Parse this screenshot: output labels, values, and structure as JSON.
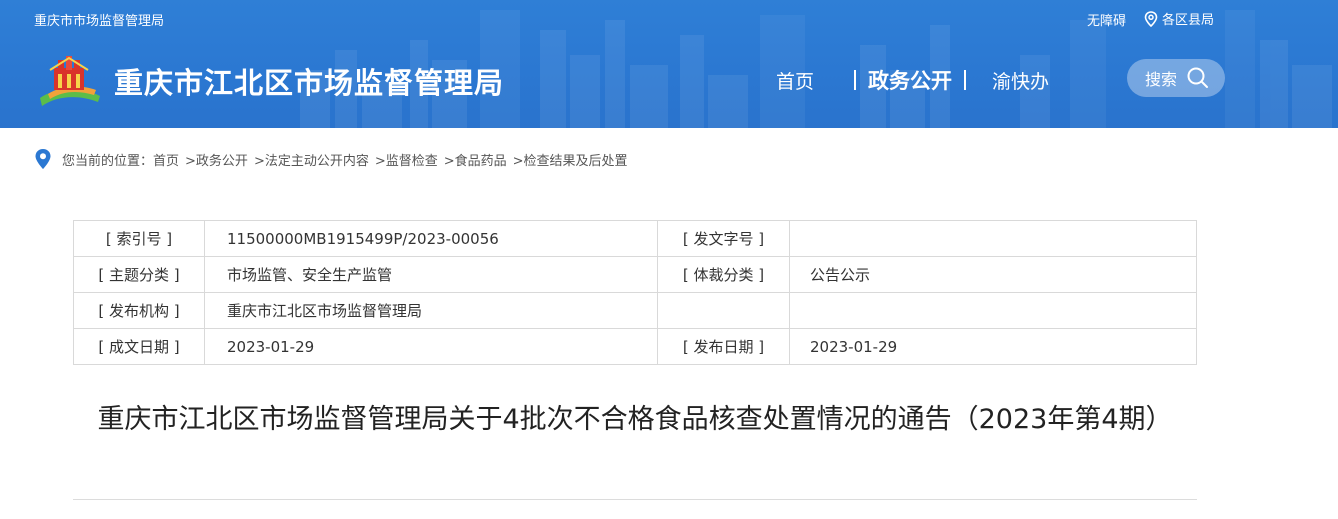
{
  "header": {
    "site_small": "重庆市市场监督管理局",
    "accessible": "无障碍",
    "district": "各区县局",
    "site_title": "重庆市江北区市场监督管理局",
    "nav": {
      "home": "首页",
      "gov": "政务公开",
      "yukuaiban": "渝快办"
    },
    "search_label": "搜索"
  },
  "breadcrumb": {
    "prefix": "您当前的位置：",
    "items": [
      "首页",
      ">政务公开",
      ">法定主动公开内容",
      ">监督检查",
      ">食品药品",
      ">检查结果及后处置"
    ]
  },
  "meta": {
    "rows": [
      {
        "k1": "[ 索引号 ]",
        "v1": "11500000MB1915499P/2023-00056",
        "k2": "[ 发文字号 ]",
        "v2": ""
      },
      {
        "k1": "[ 主题分类 ]",
        "v1": "市场监管、安全生产监管",
        "k2": "[ 体裁分类 ]",
        "v2": "公告公示"
      },
      {
        "k1": "[ 发布机构 ]",
        "v1": "重庆市江北区市场监督管理局",
        "k2": "",
        "v2": ""
      },
      {
        "k1": "[ 成文日期 ]",
        "v1": "2023-01-29",
        "k2": "[ 发布日期 ]",
        "v2": "2023-01-29"
      }
    ]
  },
  "article": {
    "title": "重庆市江北区市场监督管理局关于4批次不合格食品核查处置情况的通告（2023年第4期）"
  },
  "colors": {
    "banner": "#2b78d2",
    "pin": "#2b78d2"
  }
}
